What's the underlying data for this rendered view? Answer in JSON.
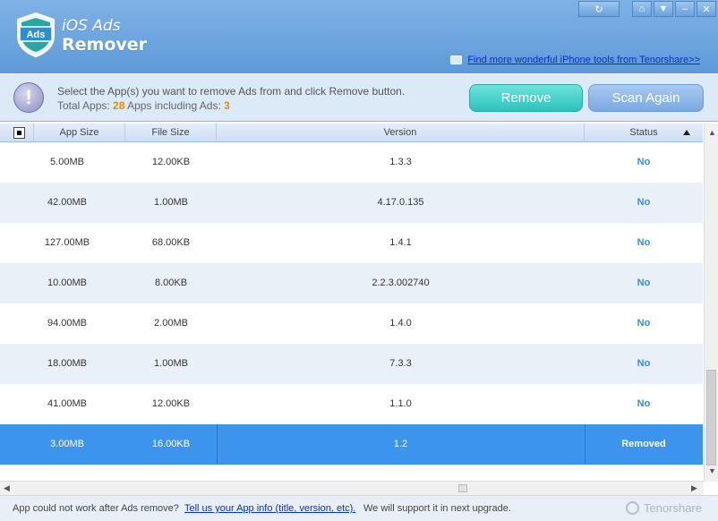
{
  "header": {
    "logo_text": "Ads",
    "title_line1": "iOS Ads",
    "title_line2": "Remover",
    "link": "Find more wonderful iPhone tools from Tenorshare>>"
  },
  "window_controls": [
    "refresh-icon",
    "home-icon",
    "dropdown-icon",
    "minimize-icon",
    "close-icon"
  ],
  "info": {
    "instruction": "Select the App(s) you want to remove Ads from and click Remove button.",
    "total_label": "Total Apps: ",
    "total_value": "28",
    "including_label": "Apps including Ads: ",
    "including_value": "3"
  },
  "buttons": {
    "remove": "Remove",
    "scan_again": "Scan Again"
  },
  "table": {
    "columns": [
      "App Size",
      "File Size",
      "Version",
      "Status"
    ],
    "rows": [
      {
        "app_size": "5.00MB",
        "file_size": "12.00KB",
        "version": "1.3.3",
        "status": "No"
      },
      {
        "app_size": "42.00MB",
        "file_size": "1.00MB",
        "version": "4.17.0.135",
        "status": "No"
      },
      {
        "app_size": "127.00MB",
        "file_size": "68.00KB",
        "version": "1.4.1",
        "status": "No"
      },
      {
        "app_size": "10.00MB",
        "file_size": "8.00KB",
        "version": "2.2.3.002740",
        "status": "No"
      },
      {
        "app_size": "94.00MB",
        "file_size": "2.00MB",
        "version": "1.4.0",
        "status": "No"
      },
      {
        "app_size": "18.00MB",
        "file_size": "1.00MB",
        "version": "7.3.3",
        "status": "No"
      },
      {
        "app_size": "41.00MB",
        "file_size": "12.00KB",
        "version": "1.1.0",
        "status": "No"
      },
      {
        "app_size": "3.00MB",
        "file_size": "16.00KB",
        "version": "1.2",
        "status": "Removed"
      }
    ]
  },
  "footer": {
    "text1": "App could not work after Ads remove?",
    "link": "Tell us your App info (title, version, etc).",
    "text2": "We will support it in next upgrade.",
    "brand": "Tenorshare"
  }
}
